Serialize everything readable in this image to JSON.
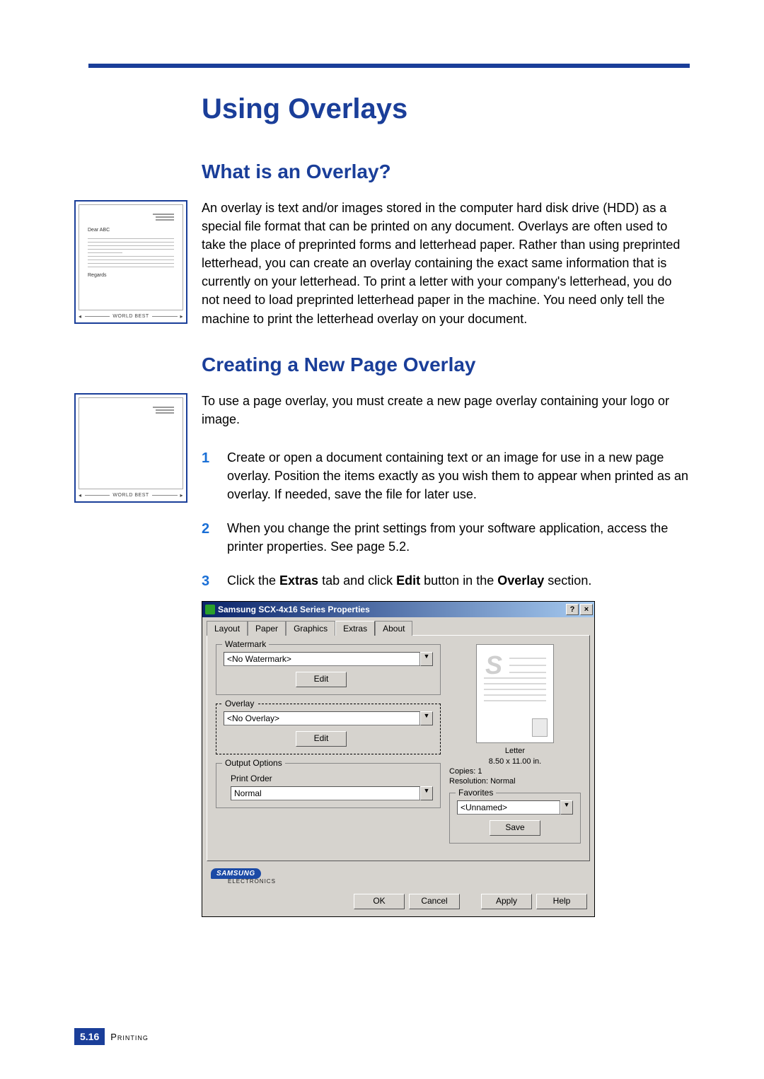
{
  "page": {
    "h1": "Using Overlays",
    "h2a": "What is an Overlay?",
    "h2b": "Creating a New Page Overlay",
    "para1": "An overlay is text and/or images stored in the computer hard disk drive (HDD) as a special file format that can be printed on any document. Overlays are often used to take the place of preprinted forms and letterhead paper. Rather than using preprinted letterhead, you can create an overlay containing the exact same information that is currently on your letterhead. To print a letter with your company's letterhead, you do not need to load preprinted letterhead paper in the machine. You need only tell the machine to print the letterhead overlay on your document.",
    "para2": "To use a page overlay, you must create a new page overlay containing your logo or image.",
    "steps": {
      "s1": "Create or open a document containing text or an image for use in a new page overlay. Position the items exactly as you wish them to appear when printed as an overlay. If needed, save the file for later use.",
      "s2": "When you change the print settings from your software application, access the printer properties. See page 5.2.",
      "s3_pre": "Click the ",
      "s3_b1": "Extras",
      "s3_mid1": " tab and click ",
      "s3_b2": "Edit",
      "s3_mid2": " button in the ",
      "s3_b3": "Overlay",
      "s3_end": " section."
    },
    "sidefig": {
      "dear": "Dear ABC",
      "regards": "Regards",
      "world_best": "WORLD BEST"
    },
    "footer": {
      "num": "5.16",
      "section": "Printing"
    }
  },
  "dialog": {
    "title": "Samsung SCX-4x16 Series Properties",
    "help_btn": "?",
    "close_btn": "×",
    "tabs": {
      "layout": "Layout",
      "paper": "Paper",
      "graphics": "Graphics",
      "extras": "Extras",
      "about": "About"
    },
    "watermark": {
      "legend": "Watermark",
      "value": "<No Watermark>",
      "edit": "Edit"
    },
    "overlay": {
      "legend": "Overlay",
      "value": "<No Overlay>",
      "edit": "Edit"
    },
    "output": {
      "legend": "Output Options",
      "label": "Print Order",
      "value": "Normal"
    },
    "preview": {
      "ps": "S",
      "paper": "Letter",
      "size": "8.50 x 11.00 in.",
      "copies": "Copies: 1",
      "resolution": "Resolution: Normal"
    },
    "favorites": {
      "legend": "Favorites",
      "value": "<Unnamed>",
      "save": "Save"
    },
    "brand": {
      "name": "SAMSUNG",
      "sub": "ELECTRONICS"
    },
    "buttons": {
      "ok": "OK",
      "cancel": "Cancel",
      "apply": "Apply",
      "help": "Help"
    }
  }
}
